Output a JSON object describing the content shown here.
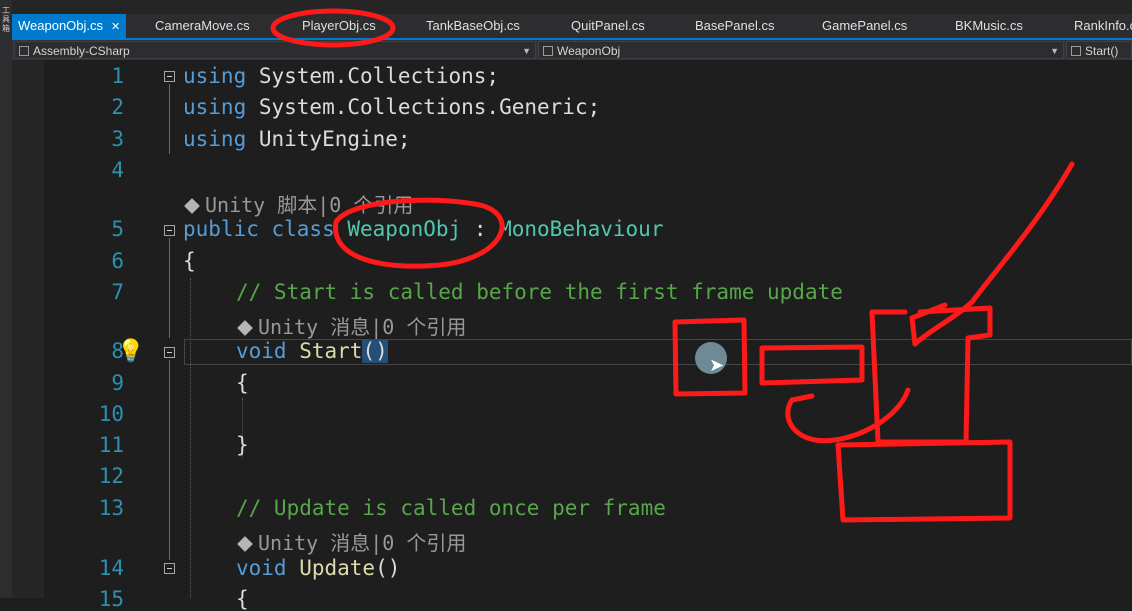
{
  "tabs": [
    {
      "label": "WeaponObj.cs",
      "active": true
    },
    {
      "label": "CameraMove.cs"
    },
    {
      "label": "PlayerObj.cs"
    },
    {
      "label": "TankBaseObj.cs"
    },
    {
      "label": "QuitPanel.cs"
    },
    {
      "label": "BasePanel.cs"
    },
    {
      "label": "GamePanel.cs"
    },
    {
      "label": "BKMusic.cs"
    },
    {
      "label": "RankInfo.cs"
    }
  ],
  "tab_close_glyph": "✕",
  "left_strip_text": [
    "工",
    "具",
    "箱"
  ],
  "navbar": {
    "project": "Assembly-CSharp",
    "type": "WeaponObj",
    "member": "Start()"
  },
  "line_numbers": [
    "1",
    "2",
    "3",
    "4",
    "5",
    "6",
    "7",
    "8",
    "9",
    "10",
    "11",
    "12",
    "13",
    "14",
    "15"
  ],
  "code": {
    "l1_kw": "using",
    "l1_rest": " System.Collections;",
    "l2_kw": "using",
    "l2_rest": " System.Collections.Generic;",
    "l3_kw": "using",
    "l3_rest": " UnityEngine;",
    "lens_class": "Unity 脚本|0 个引用",
    "l5_kw1": "public",
    "l5_kw2": " class ",
    "l5_type": "WeaponObj",
    "l5_colon": " : ",
    "l5_base": "MonoBehaviour",
    "l6": "{",
    "l7": "// Start is called before the first frame update",
    "lens_start": "Unity 消息|0 个引用",
    "l8_kw": "void",
    "l8_fn": " Start",
    "l8_paren": "()",
    "l9": "{",
    "l11": "}",
    "l13": "// Update is called once per frame",
    "lens_update": "Unity 消息|0 个引用",
    "l14_kw": "void",
    "l14_fn": " Update",
    "l14_paren": "()",
    "l15": "{"
  },
  "colors": {
    "accent": "#007acc",
    "ink": "#ff1a1a",
    "keyword": "#569cd6",
    "type": "#4ec9b0",
    "comment": "#57a64a",
    "line_number": "#2b91af"
  },
  "icons": [
    "lightbulb-icon",
    "unity-cube-icon",
    "fold-minus-icon",
    "mouse-pointer-icon",
    "dropdown-caret-icon"
  ]
}
